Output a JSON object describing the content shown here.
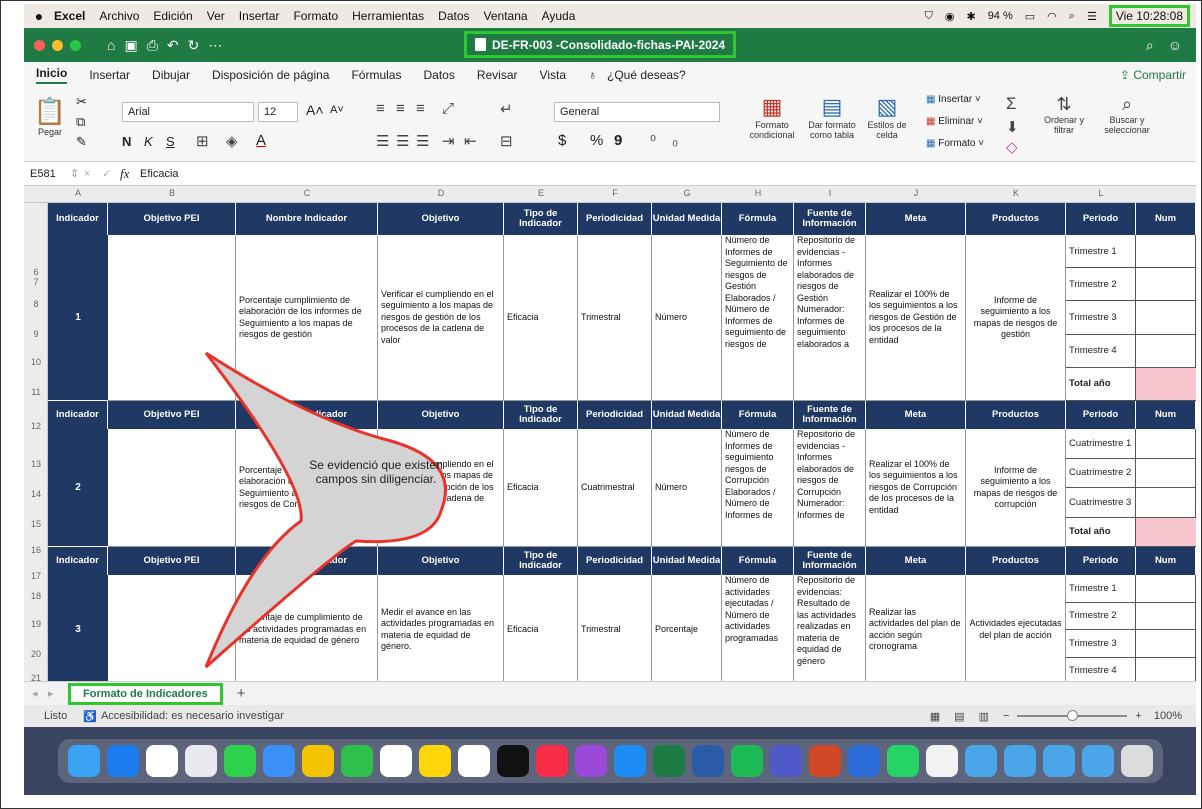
{
  "menubar": {
    "app": "Excel",
    "items": [
      "Archivo",
      "Edición",
      "Ver",
      "Insertar",
      "Formato",
      "Herramientas",
      "Datos",
      "Ventana",
      "Ayuda"
    ],
    "battery": "94 %",
    "clock": "Vie 10:28:08"
  },
  "window": {
    "title": "DE-FR-003 -Consolidado-fichas-PAI-2024",
    "accent": "#1f7a44"
  },
  "tabs": [
    "Inicio",
    "Insertar",
    "Dibujar",
    "Disposición de página",
    "Fórmulas",
    "Datos",
    "Revisar",
    "Vista"
  ],
  "tell_me": "¿Qué deseas?",
  "share": "Compartir",
  "ribbon": {
    "paste": "Pegar",
    "font": "Arial",
    "size": "12",
    "bold": "N",
    "italic": "K",
    "underline": "S",
    "grow": "A",
    "number_format": "General",
    "currency": "$",
    "percent": "%",
    "comma": "9",
    "cond_format": "Formato condicional",
    "table_format": "Dar formato como tabla",
    "cell_styles": "Estilos de celda",
    "insert": "Insertar",
    "delete": "Eliminar",
    "format": "Formato",
    "sort": "Ordenar y filtrar",
    "find": "Buscar y seleccionar"
  },
  "formula": {
    "cellref": "E581",
    "fx": "fx",
    "value": "Eficacia"
  },
  "columns": [
    "A",
    "B",
    "C",
    "D",
    "E",
    "F",
    "G",
    "H",
    "I",
    "J",
    "K",
    "L"
  ],
  "rows": [
    "6",
    "7",
    "8",
    "9",
    "10",
    "11",
    "12",
    "13",
    "14",
    "15",
    "16",
    "17",
    "18",
    "19",
    "20",
    "21"
  ],
  "headers": [
    "Indicador",
    "Objetivo PEI",
    "Nombre Indicador",
    "Objetivo",
    "Tipo de Indicador",
    "Periodicidad",
    "Unidad Medida",
    "Fórmula",
    "Fuente de Información",
    "Meta",
    "Productos",
    "Periodo",
    "Num"
  ],
  "blocks": [
    {
      "id": "1",
      "nombre": "Porcentaje cumplimiento de elaboración de los informes de Seguimiento a los mapas de riesgos de gestión",
      "objetivo": "Verificar el cumpliendo en el seguimiento a los mapas de riesgos de gestión de los procesos de la cadena de valor",
      "tipo": "Eficacia",
      "periodicidad": "Trimestral",
      "unidad": "Número",
      "formula": "Número de Informes de Seguimiento de riesgos de Gestión Elaborados / Número de Informes de seguimiento de riesgos de",
      "fuente": "Repositorio de evidencias - Informes elaborados de riesgos de Gestión Numerador: Informes de seguimiento elaborados a",
      "meta": "Realizar el 100% de los seguimientos a los riesgos de Gestión de los procesos de la entidad",
      "productos": "Informe de seguimiento a los mapas de riesgos de gestión",
      "periodos": [
        "Trimestre 1",
        "Trimestre 2",
        "Trimestre 3",
        "Trimestre 4",
        "Total año"
      ]
    },
    {
      "id": "2",
      "nombre": "Porcentaje cumplimiento de elaboración de los informes de Seguimiento a los mapas de riesgos de Corrupción",
      "objetivo": "Verificar el cumpliendo en el seguimiento a los mapas de riesgos de corrupción de los procesos de la cadena de valor",
      "tipo": "Eficacia",
      "periodicidad": "Cuatrimestral",
      "unidad": "Número",
      "formula": "Número de Informes de seguimiento riesgos de Corrupción Elaborados / Número de Informes de",
      "fuente": "Repositorio de evidencias - Informes elaborados de riesgos de Corrupción Numerador: Informes de",
      "meta": "Realizar el 100% de los seguimientos a los riesgos de Corrupción de los procesos de la entidad",
      "productos": "Informe de seguimiento a los mapas de riesgos de corrupción",
      "periodos": [
        "Cuatrimestre 1",
        "Cuatrimestre 2",
        "Cuatrimestre 3",
        "Total año"
      ]
    },
    {
      "id": "3",
      "nombre": "Porcentaje de cumplimiento de las actividades programadas en materia de equidad de género",
      "objetivo": "Medir el avance en las actividades programadas en materia de equidad de género.",
      "tipo": "Eficacia",
      "periodicidad": "Trimestral",
      "unidad": "Porcentaje",
      "formula": "Número de actividades ejecutadas / Número de actividades programadas",
      "fuente": "Repositorio de evidencias: Resultado de las actividades realizadas en materia de equidad de género",
      "meta": "Realizar las actividades del plan de acción según cronograma",
      "productos": "Actividades ejecutadas del plan de acción",
      "periodos": [
        "Trimestre 1",
        "Trimestre 2",
        "Trimestre 3",
        "Trimestre 4"
      ]
    }
  ],
  "callout": "Se evidenció que existen campos sin diligenciar.",
  "sheet_tab": "Formato de Indicadores",
  "add_sheet": "+",
  "status": {
    "ready": "Listo",
    "accessibility": "Accesibilidad: es necesario investigar",
    "zoom": "100%"
  },
  "colors": {
    "header": "#1f3864",
    "highlight": "#2ec82e",
    "callout_stroke": "#e8332a",
    "empty_total": "#f7c6cf"
  }
}
